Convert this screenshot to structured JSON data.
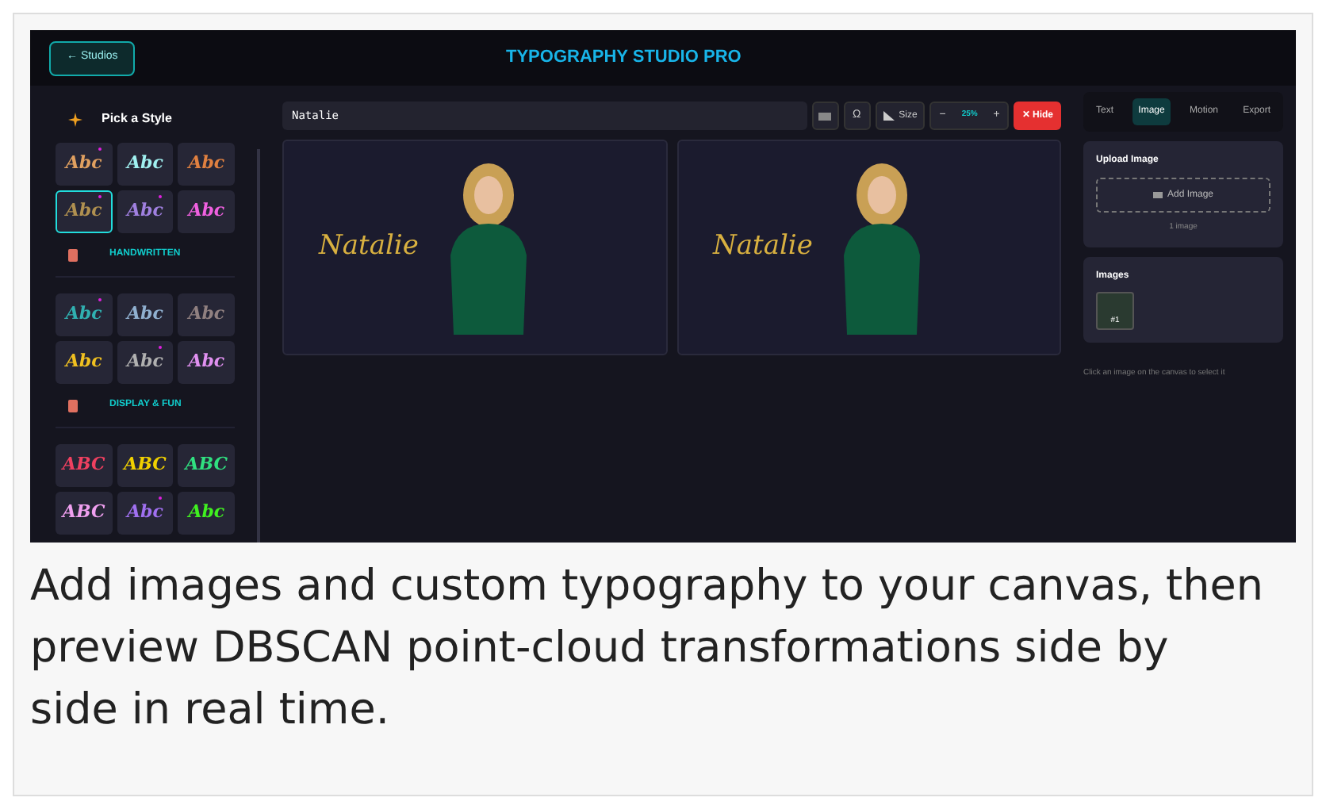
{
  "header": {
    "back_button": "← Studios",
    "title": "TYPOGRAPHY STUDIO PRO"
  },
  "sidebar": {
    "title": "Pick a Style",
    "groups": [
      {
        "styles": [
          {
            "sample": "Abc",
            "color": "#e0a060",
            "selected": false,
            "new": true
          },
          {
            "sample": "Abc",
            "color": "#a0f0f0",
            "selected": false,
            "new": false
          },
          {
            "sample": "Abc",
            "color": "#e08040",
            "selected": false,
            "new": false
          },
          {
            "sample": "Abc",
            "color": "#b09050",
            "selected": true,
            "new": true
          },
          {
            "sample": "Abc",
            "color": "#a080e0",
            "selected": false,
            "new": true
          },
          {
            "sample": "Abc",
            "color": "#f060e0",
            "selected": false,
            "new": false
          }
        ]
      },
      {
        "heading": "HANDWRITTEN",
        "styles": [
          {
            "sample": "Abc",
            "color": "#30b0b0",
            "selected": false,
            "new": true
          },
          {
            "sample": "Abc",
            "color": "#90b0d0",
            "selected": false,
            "new": false
          },
          {
            "sample": "Abc",
            "color": "#908080",
            "selected": false,
            "new": false
          },
          {
            "sample": "Abc",
            "color": "#f0c020",
            "selected": false,
            "new": false
          },
          {
            "sample": "Abc",
            "color": "#b0b0b0",
            "selected": false,
            "new": true
          },
          {
            "sample": "Abc",
            "color": "#e090f0",
            "selected": false,
            "new": false
          }
        ]
      },
      {
        "heading": "DISPLAY & FUN",
        "styles": [
          {
            "sample": "ABC",
            "color": "#f04060",
            "selected": false,
            "new": false
          },
          {
            "sample": "ABC",
            "color": "#f0d000",
            "selected": false,
            "new": false
          },
          {
            "sample": "ABC",
            "color": "#30e080",
            "selected": false,
            "new": false
          },
          {
            "sample": "ABC",
            "color": "#f0a0f0",
            "selected": false,
            "new": false
          },
          {
            "sample": "Abc",
            "color": "#a070f0",
            "selected": false,
            "new": true
          },
          {
            "sample": "Abc",
            "color": "#40f020",
            "selected": false,
            "new": false
          }
        ]
      }
    ]
  },
  "toolbar": {
    "text_value": "Natalie",
    "symbol_button": "Ω",
    "size_button": "Size",
    "minus": "−",
    "zoom": "25%",
    "plus": "+",
    "hide_button": "✕ Hide"
  },
  "canvases": [
    {
      "text": "Natalie"
    },
    {
      "text": "Natalie"
    }
  ],
  "tabs": [
    {
      "label": "Text",
      "selected": false
    },
    {
      "label": "Image",
      "selected": true
    },
    {
      "label": "Motion",
      "selected": false
    },
    {
      "label": "Export",
      "selected": false
    }
  ],
  "upload": {
    "title": "Upload Image",
    "button": "Add Image",
    "count": "1 image"
  },
  "images": {
    "title": "Images",
    "thumb_label": "#1"
  },
  "hint": "Click an image on the canvas to select it",
  "caption": "Add images and custom typography to your canvas, then preview DBSCAN point-cloud transformations side by side in real time."
}
